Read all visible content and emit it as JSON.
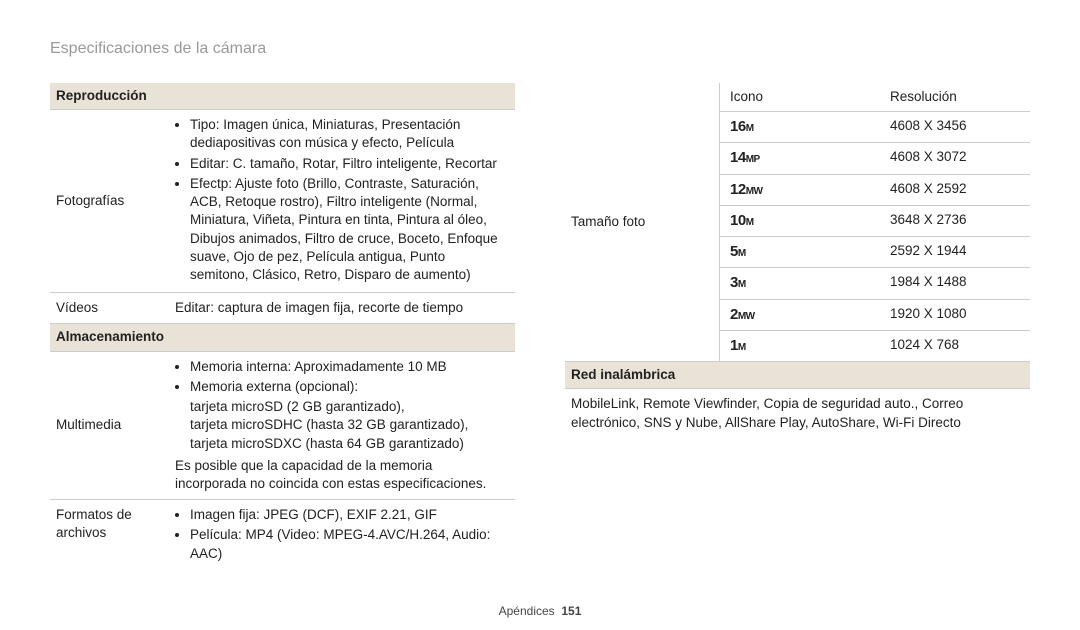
{
  "page_title": "Especificaciones de la cámara",
  "left": {
    "section1_head": "Reproducción",
    "fotografias_label": "Fotografías",
    "fotografias_b1": "Tipo: Imagen única, Miniaturas, Presentación dediapositivas con música y efecto, Película",
    "fotografias_b2": "Editar: C. tamaño, Rotar, Filtro inteligente, Recortar",
    "fotografias_b3": "Efectp: Ajuste foto (Brillo, Contraste, Saturación, ACB, Retoque rostro), Filtro inteligente (Normal, Miniatura, Viñeta, Pintura en tinta, Pintura al óleo, Dibujos animados, Filtro de cruce, Boceto, Enfoque suave, Ojo de pez, Película antigua, Punto semitono, Clásico, Retro, Disparo de aumento)",
    "videos_label": "Vídeos",
    "videos_text": "Editar: captura de imagen fija, recorte de tiempo",
    "section2_head": "Almacenamiento",
    "multimedia_label": "Multimedia",
    "multimedia_b1": "Memoria interna: Aproximadamente 10 MB",
    "multimedia_b2": "Memoria externa (opcional):",
    "multimedia_sub1": "tarjeta microSD (2 GB garantizado),",
    "multimedia_sub2": "tarjeta microSDHC (hasta 32 GB garantizado),",
    "multimedia_sub3": "tarjeta microSDXC (hasta 64 GB garantizado)",
    "multimedia_note": "Es posible que la capacidad de la memoria incorporada no coincida con estas especificaciones.",
    "formatos_label1": "Formatos de",
    "formatos_label2": "archivos",
    "formatos_b1": "Imagen fija: JPEG (DCF), EXIF 2.21, GIF",
    "formatos_b2": "Película: MP4 (Video: MPEG-4.AVC/H.264, Audio: AAC)"
  },
  "right": {
    "size_label": "Tamaño foto",
    "th1": "Icono",
    "th2": "Resolución",
    "rows": [
      {
        "big": "16",
        "sub": "M",
        "res": "4608 X 3456"
      },
      {
        "big": "14",
        "sub": "MP",
        "res": "4608 X 3072"
      },
      {
        "big": "12",
        "sub": "MW",
        "res": "4608 X 2592"
      },
      {
        "big": "10",
        "sub": "M",
        "res": "3648 X 2736"
      },
      {
        "big": "5",
        "sub": "M",
        "res": "2592 X 1944"
      },
      {
        "big": "3",
        "sub": "M",
        "res": "1984 X 1488"
      },
      {
        "big": "2",
        "sub": "MW",
        "res": "1920 X 1080"
      },
      {
        "big": "1",
        "sub": "M",
        "res": "1024 X 768"
      }
    ],
    "section_head": "Red inalámbrica",
    "wireless_text": "MobileLink, Remote Viewfinder, Copia de seguridad auto., Correo electrónico, SNS y Nube, AllShare Play, AutoShare, Wi-Fi Directo"
  },
  "footer_label": "Apéndices",
  "footer_page": "151"
}
